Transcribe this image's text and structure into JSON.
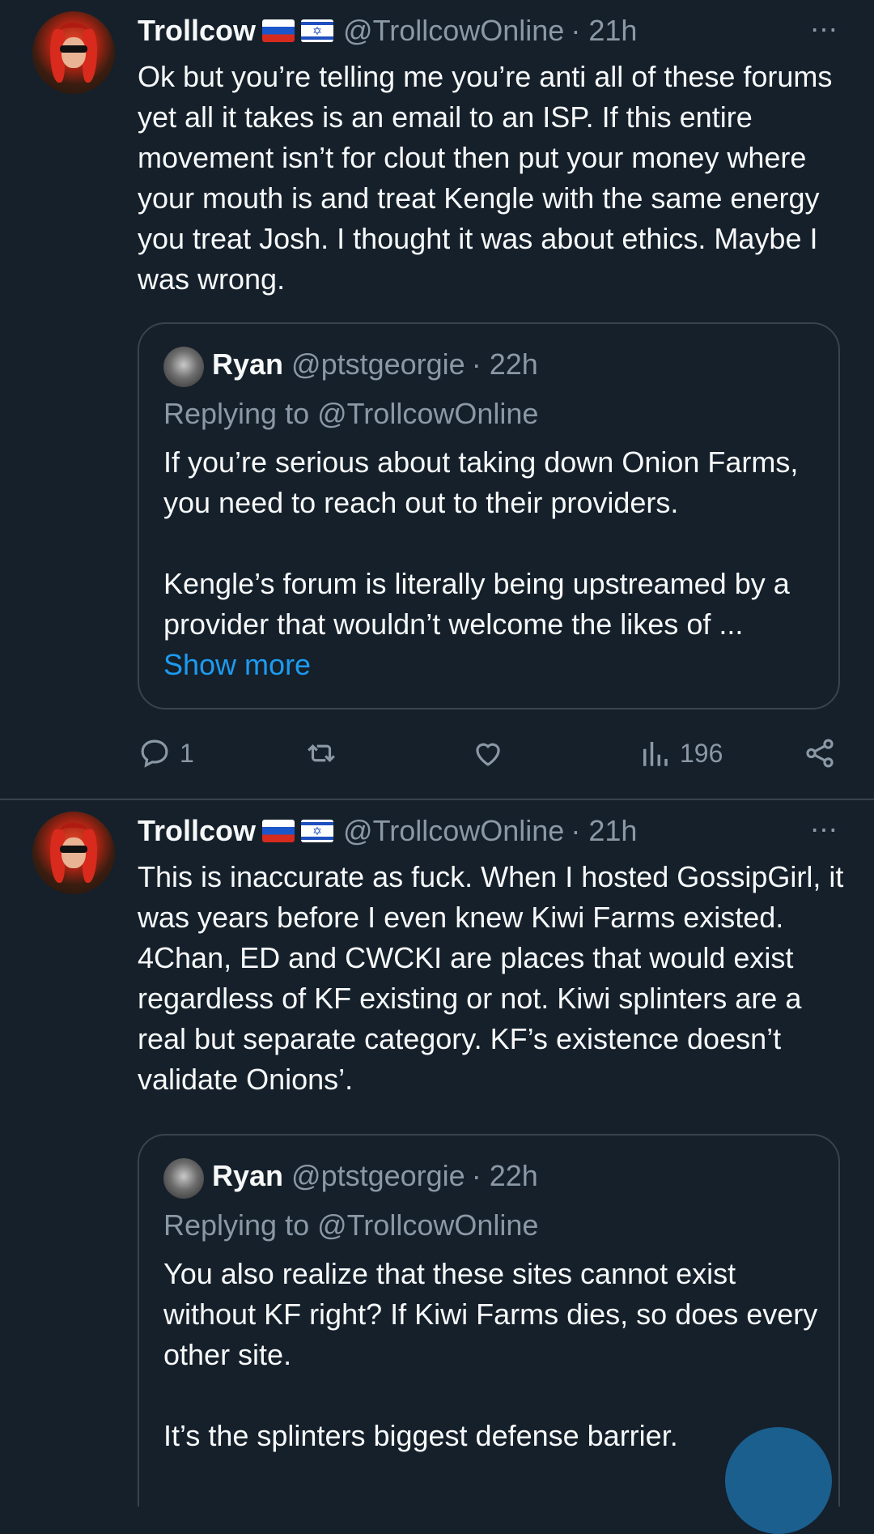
{
  "tweets": [
    {
      "author": {
        "name": "Trollcow",
        "handle": "@TrollcowOnline",
        "time": "· 21h",
        "flags": [
          "russia-flag",
          "israel-flag"
        ]
      },
      "text": "Ok but you’re telling me you’re anti all of these forums yet all it takes is an email to an ISP. If this entire movement isn’t for clout then put your money where your mouth is and treat Kengle with the same energy you treat Josh. I thought it was about ethics. Maybe I was wrong.",
      "more_icon": "⋯",
      "quote": {
        "name": "Ryan",
        "handle": "@ptstgeorgie",
        "time": "· 22h",
        "replying_to": "Replying to @TrollcowOnline",
        "paragraphs": [
          "If you’re serious about taking down Onion Farms, you need to reach out to their providers.",
          "Kengle’s forum is literally being upstreamed by a provider that wouldn’t welcome the likes of ..."
        ],
        "show_more": "Show more"
      },
      "actions": {
        "reply_count": "1",
        "views": "196"
      }
    },
    {
      "author": {
        "name": "Trollcow",
        "handle": "@TrollcowOnline",
        "time": "· 21h",
        "flags": [
          "russia-flag",
          "israel-flag"
        ]
      },
      "text": "This is inaccurate as fuck. When I hosted GossipGirl, it was years before I even knew Kiwi Farms existed. 4Chan, ED and CWCKI are places that would exist regardless of KF existing or not. Kiwi splinters are a real but separate category. KF’s existence doesn’t validate Onions’.",
      "more_icon": "⋯",
      "quote": {
        "name": "Ryan",
        "handle": "@ptstgeorgie",
        "time": "· 22h",
        "replying_to": "Replying to @TrollcowOnline",
        "paragraphs": [
          "You also realize that these sites cannot exist without KF right? If Kiwi Farms dies, so does every other site.",
          "It’s the splinters biggest defense barrier."
        ]
      }
    }
  ],
  "colors": {
    "background": "#15202b",
    "text": "#f7f9f9",
    "secondary": "#8b98a5",
    "link": "#1d9bf0",
    "border": "#38444d"
  }
}
